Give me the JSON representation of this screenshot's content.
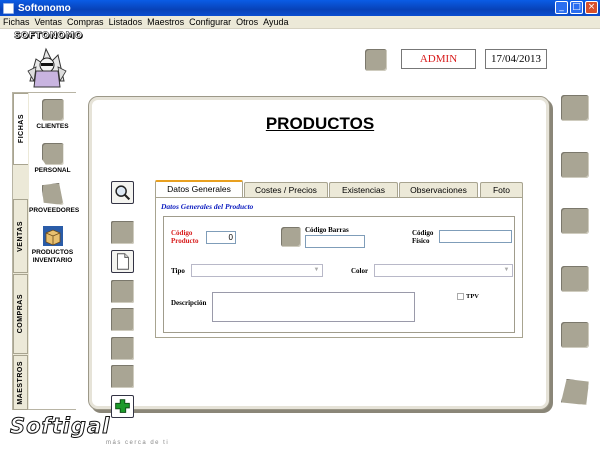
{
  "window": {
    "title": "Softonomo",
    "minimize": "_",
    "maximize": "□",
    "close": "×"
  },
  "menu": [
    "Fichas",
    "Ventas",
    "Compras",
    "Listados",
    "Maestros",
    "Configurar",
    "Otros",
    "Ayuda"
  ],
  "brand": {
    "top_logo": "SOFTONOMO",
    "bottom_logo": "Softigal",
    "bottom_tagline": "más cerca de ti"
  },
  "header": {
    "user": "ADMIN",
    "date": "17/04/2013",
    "user_color": "#d81c1c"
  },
  "side_tabs": [
    "FICHAS",
    "VENTAS",
    "COMPRAS",
    "MAESTROS"
  ],
  "side_items": [
    "CLIENTES",
    "PERSONAL",
    "PROVEEDORES",
    "PRODUCTOS INVENTARIO"
  ],
  "form": {
    "title": "PRODUCTOS",
    "tabs": [
      "Datos Generales",
      "Costes / Precios",
      "Existencias",
      "Observaciones",
      "Foto"
    ],
    "section_title": "Datos Generales del Producto",
    "codigo_producto_label": "Código Producto",
    "codigo_producto_value": "0",
    "codigo_barras_label": "Código Barras",
    "codigo_fisico_label": "Código Físico",
    "tipo_label": "Tipo",
    "color_label": "Color",
    "descripcion_label": "Descripción",
    "tpv_label": "TPV",
    "accent_label_color": "#d81c1c",
    "tab_active_color": "#e8a020"
  },
  "icons": [
    "search-icon",
    "new-document-icon",
    "exit-puzzle-icon"
  ]
}
